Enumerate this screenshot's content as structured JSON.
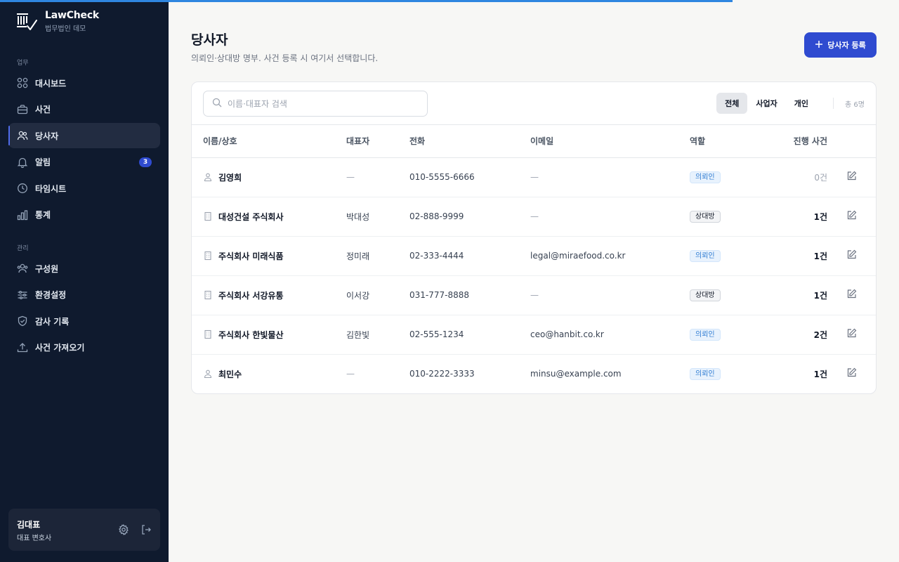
{
  "progress": {
    "fraction": 0.815,
    "color": "#2f86e0"
  },
  "brand": {
    "name": "LawCheck",
    "subtitle": "법무법인 데모"
  },
  "sidebar": {
    "section_work": "업무",
    "work_items": [
      {
        "label": "대시보드",
        "icon": "dashboard-icon"
      },
      {
        "label": "사건",
        "icon": "briefcase-icon"
      },
      {
        "label": "당사자",
        "icon": "users-icon",
        "active": true
      },
      {
        "label": "알림",
        "icon": "bell-icon",
        "badge": "3"
      },
      {
        "label": "타임시트",
        "icon": "clock-icon"
      },
      {
        "label": "통계",
        "icon": "bar-chart-icon"
      }
    ],
    "section_admin": "관리",
    "admin_items": [
      {
        "label": "구성원",
        "icon": "members-icon"
      },
      {
        "label": "환경설정",
        "icon": "sliders-icon"
      },
      {
        "label": "감사 기록",
        "icon": "shield-icon"
      },
      {
        "label": "사건 가져오기",
        "icon": "upload-icon"
      }
    ]
  },
  "user": {
    "name": "김대표",
    "role": "대표 변호사"
  },
  "header": {
    "title": "당사자",
    "subtitle": "의뢰인·상대방 명부. 사건 등록 시 여기서 선택합니다.",
    "add_button": "당사자 등록"
  },
  "toolbar": {
    "search_placeholder": "이름·대표자 검색",
    "filters": [
      "전체",
      "사업자",
      "개인"
    ],
    "active_filter": "전체",
    "total": "총 6명"
  },
  "table": {
    "columns": [
      "이름/상호",
      "대표자",
      "전화",
      "이메일",
      "역할",
      "진행 사건"
    ],
    "rows": [
      {
        "type": "person",
        "name": "김영희",
        "rep": "—",
        "phone": "010-5555-6666",
        "email": "—",
        "role": "의뢰인",
        "role_type": "client",
        "count": "0건"
      },
      {
        "type": "company",
        "name": "대성건설 주식회사",
        "rep": "박대성",
        "phone": "02-888-9999",
        "email": "—",
        "role": "상대방",
        "role_type": "opponent",
        "count": "1건"
      },
      {
        "type": "company",
        "name": "주식회사 미래식품",
        "rep": "정미래",
        "phone": "02-333-4444",
        "email": "legal@miraefood.co.kr",
        "role": "의뢰인",
        "role_type": "client",
        "count": "1건"
      },
      {
        "type": "company",
        "name": "주식회사 서강유통",
        "rep": "이서강",
        "phone": "031-777-8888",
        "email": "—",
        "role": "상대방",
        "role_type": "opponent",
        "count": "1건"
      },
      {
        "type": "company",
        "name": "주식회사 한빛물산",
        "rep": "김한빛",
        "phone": "02-555-1234",
        "email": "ceo@hanbit.co.kr",
        "role": "의뢰인",
        "role_type": "client",
        "count": "2건"
      },
      {
        "type": "person",
        "name": "최민수",
        "rep": "—",
        "phone": "010-2222-3333",
        "email": "minsu@example.com",
        "role": "의뢰인",
        "role_type": "client",
        "count": "1건"
      }
    ]
  },
  "colors": {
    "sidebar_bg": "#0f1a2e",
    "accent": "#2f4bd0",
    "client_badge": "#2f7cd3"
  }
}
